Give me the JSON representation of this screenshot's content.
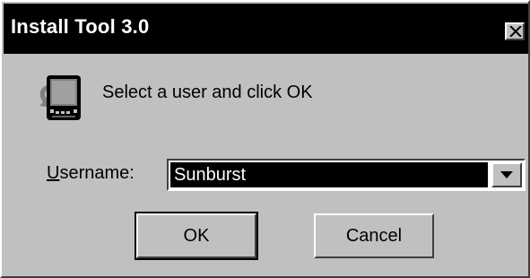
{
  "window": {
    "title": "Install Tool 3.0",
    "close_icon": "close-icon"
  },
  "header": {
    "icon": "handheld-device-icon",
    "prompt": "Select a user and click OK"
  },
  "form": {
    "username_label_mnemonic": "U",
    "username_label_rest": "sername:",
    "username_selected": "Sunburst",
    "dropdown_icon": "chevron-down-icon"
  },
  "buttons": {
    "ok_label": "OK",
    "cancel_label": "Cancel"
  },
  "colors": {
    "titlebar": "#000000",
    "dialog": "#c0c0c0",
    "selection": "#000000"
  }
}
